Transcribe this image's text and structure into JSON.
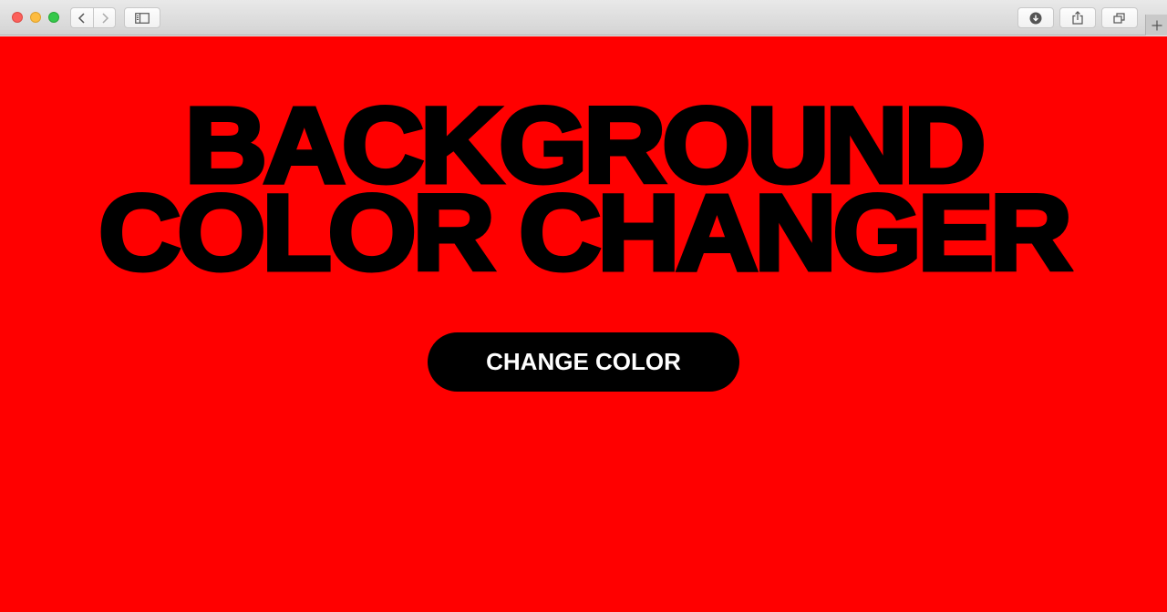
{
  "browser": {
    "icons": {
      "back": "chevron-left-icon",
      "forward": "chevron-right-icon",
      "sidebar": "sidebar-icon",
      "download": "download-icon",
      "share": "share-icon",
      "tabs": "tab-overview-icon",
      "new_tab": "plus-icon"
    }
  },
  "page": {
    "background_color": "#ff0000",
    "heading_lines": [
      "BACKGROUND",
      "COLOR CHANGER"
    ],
    "button_label": "CHANGE COLOR"
  }
}
